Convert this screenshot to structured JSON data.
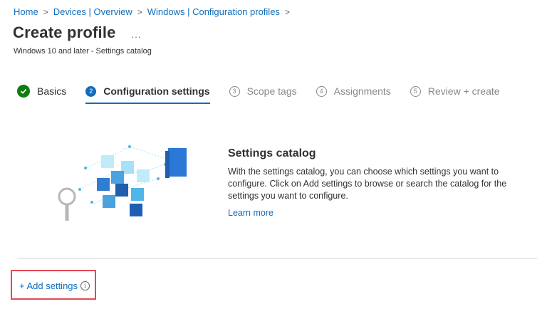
{
  "breadcrumb": {
    "items": [
      "Home",
      "Devices | Overview",
      "Windows | Configuration profiles"
    ],
    "separator": ">"
  },
  "header": {
    "title": "Create profile",
    "more": "...",
    "subtitle": "Windows 10 and later - Settings catalog"
  },
  "steps": [
    {
      "number": "",
      "label": "Basics",
      "state": "done"
    },
    {
      "number": "2",
      "label": "Configuration settings",
      "state": "active"
    },
    {
      "number": "3",
      "label": "Scope tags",
      "state": "pending"
    },
    {
      "number": "4",
      "label": "Assignments",
      "state": "pending"
    },
    {
      "number": "5",
      "label": "Review + create",
      "state": "pending"
    }
  ],
  "catalog": {
    "heading": "Settings catalog",
    "description": "With the settings catalog, you can choose which settings you want to configure. Click on Add settings to browse or search the catalog for the settings you want to configure.",
    "learn_more": "Learn more",
    "illustration_icon": "settings-catalog-illustration"
  },
  "actions": {
    "add_settings": "+ Add settings",
    "info_glyph": "i"
  },
  "colors": {
    "link": "#0f6cbd",
    "done": "#107c10",
    "highlight": "#e74856"
  }
}
